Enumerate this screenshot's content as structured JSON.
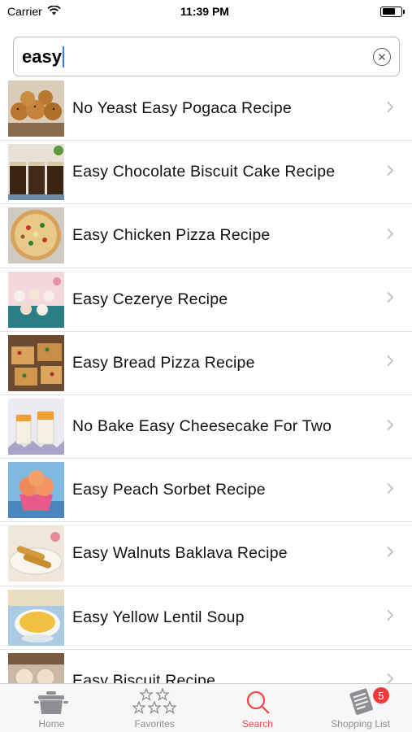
{
  "status_bar": {
    "carrier": "Carrier",
    "time": "11:39 PM",
    "battery_level": 0.7
  },
  "search": {
    "value": "easy",
    "clear_icon": "clear-circle-icon"
  },
  "results": [
    {
      "title": "No Yeast Easy Pogaca Recipe",
      "thumb": "pogaca-photo"
    },
    {
      "title": "Easy Chocolate Biscuit Cake Recipe",
      "thumb": "chocolate-biscuit-cake-photo"
    },
    {
      "title": "Easy Chicken Pizza Recipe",
      "thumb": "chicken-pizza-photo"
    },
    {
      "title": "Easy Cezerye Recipe",
      "thumb": "cezerye-photo"
    },
    {
      "title": "Easy Bread Pizza Recipe",
      "thumb": "bread-pizza-photo"
    },
    {
      "title": "No Bake Easy Cheesecake For Two",
      "thumb": "cheesecake-photo"
    },
    {
      "title": "Easy Peach Sorbet Recipe",
      "thumb": "peach-sorbet-photo"
    },
    {
      "title": "Easy Walnuts Baklava Recipe",
      "thumb": "baklava-photo"
    },
    {
      "title": "Easy Yellow Lentil Soup",
      "thumb": "lentil-soup-photo"
    },
    {
      "title": "Easy Biscuit Recipe",
      "thumb": "biscuit-photo"
    }
  ],
  "tabs": [
    {
      "label": "Home",
      "icon": "pot-icon",
      "active": false
    },
    {
      "label": "Favorites",
      "icon": "stars-icon",
      "active": false
    },
    {
      "label": "Search",
      "icon": "search-icon",
      "active": true
    },
    {
      "label": "Shopping List",
      "icon": "notepad-icon",
      "active": false,
      "badge": "5"
    }
  ],
  "colors": {
    "accent": "#f04848",
    "badge": "#f03a3a",
    "caret": "#3478f6",
    "tab_inactive": "#8e8e93"
  }
}
